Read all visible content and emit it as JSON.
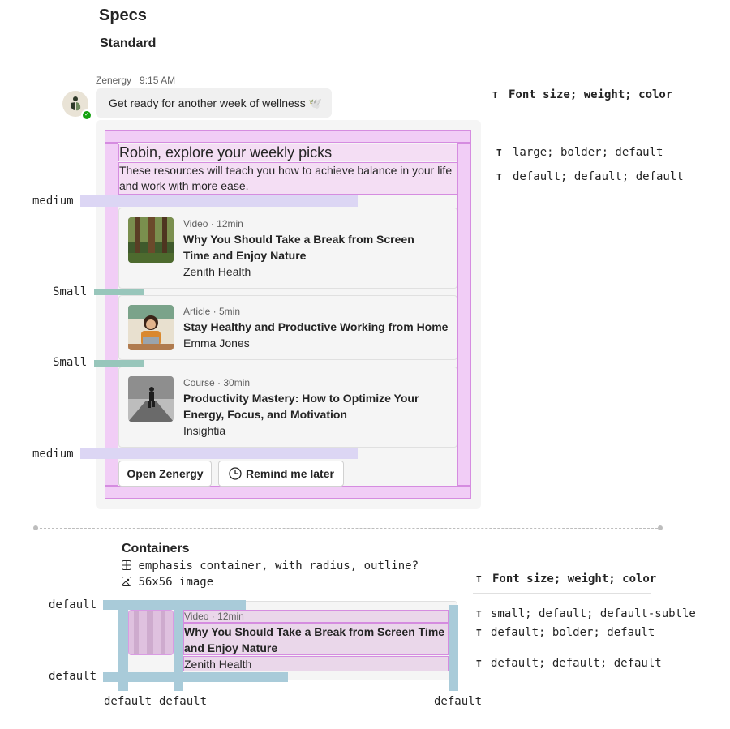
{
  "page": {
    "title": "Specs",
    "subtitle": "Standard"
  },
  "message": {
    "sender": "Zenergy",
    "time": "9:15 AM",
    "bubble_text": "Get ready for another week of wellness",
    "bubble_emoji": "🕊️"
  },
  "card": {
    "title": "Robin, explore your weekly picks",
    "body": "These resources will teach you how to achieve balance in your life and work with more ease.",
    "items": [
      {
        "meta": "Video · 12min",
        "title": "Why You Should Take a Break from Screen Time and Enjoy Nature",
        "author": "Zenith Health",
        "thumb": "forest-image"
      },
      {
        "meta": "Article · 5min",
        "title": "Stay Healthy and Productive Working from Home",
        "author": "Emma Jones",
        "thumb": "woman-laptop-image"
      },
      {
        "meta": "Course · 30min",
        "title": "Productivity Mastery: How to Optimize Your Energy, Focus, and Motivation",
        "author": "Insightia",
        "thumb": "runner-image"
      }
    ],
    "buttons": {
      "open": "Open Zenergy",
      "remind": "Remind me later"
    }
  },
  "spacing_labels": {
    "medium": "medium",
    "small": "Small"
  },
  "type_specs": {
    "header": "Font size; weight; color",
    "rows": [
      "large; bolder; default",
      "default; default; default"
    ]
  },
  "containers": {
    "title": "Containers",
    "line1": "emphasis container, with radius, outline?",
    "line2": "56x56 image",
    "example": {
      "meta": "Video · 12min",
      "title": "Why You Should Take a Break from Screen Time and Enjoy Nature",
      "author": "Zenith Health"
    },
    "spacing_label": "default",
    "type_specs": {
      "header": "Font size; weight; color",
      "rows": [
        "small; default; default-subtle",
        "default; bolder; default",
        "default; default; default"
      ]
    }
  },
  "colors": {
    "outline_pink": "#d58ce0",
    "fill_pink": "#f1cdf6",
    "lavender": "#dcd6f4",
    "teal": "#98c6bb",
    "blue": "#a9cbd9",
    "presence": "#13a10e"
  }
}
